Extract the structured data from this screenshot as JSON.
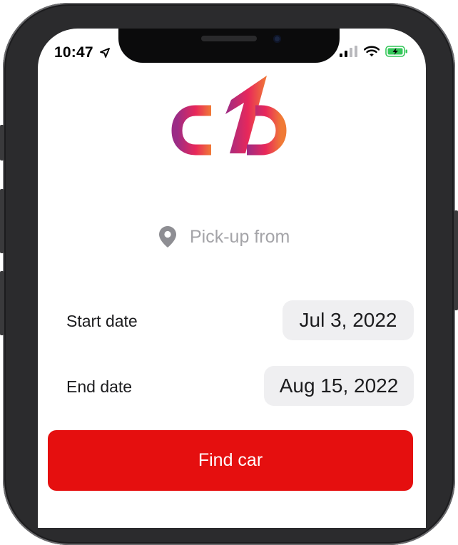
{
  "status_bar": {
    "time": "10:47",
    "location_icon": "location-arrow-icon",
    "signal_icon": "cellular-signal-icon",
    "wifi_icon": "wifi-icon",
    "battery_icon": "battery-charging-icon",
    "battery_color": "#34c759"
  },
  "logo": {
    "icon": "car-rental-logo-icon",
    "gradient_colors": [
      "#9b2c86",
      "#e8285a",
      "#f07a36"
    ]
  },
  "pickup": {
    "icon": "map-pin-icon",
    "placeholder": "Pick-up from",
    "value": ""
  },
  "start_date": {
    "label": "Start date",
    "value": "Jul 3, 2022"
  },
  "end_date": {
    "label": "End date",
    "value": "Aug 15, 2022"
  },
  "actions": {
    "find_label": "Find car",
    "accent_color": "#e50f0f"
  }
}
